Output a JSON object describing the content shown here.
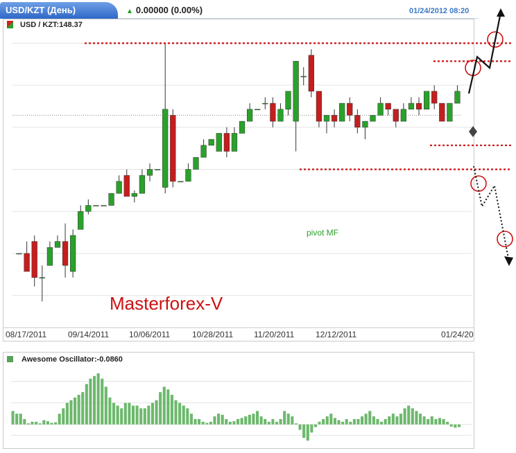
{
  "header": {
    "tab_title": "USD/KZT (День)",
    "change_text": "0.00000 (0.00%)",
    "datetime": "01/24/2012 08:20",
    "symbol_label": "USD / KZT:148.37"
  },
  "chart_data": [
    {
      "type": "candlestick",
      "title": "USD/KZT (День)",
      "x_tick_labels": [
        "08/17/2011",
        "09/14/2011",
        "10/06/2011",
        "10/28/2011",
        "11/20/2011",
        "12/12/2011",
        "01/24/20"
      ],
      "annotations": [
        "Masterforex-V",
        "pivot MF"
      ],
      "colors": {
        "up": "#2aa12a",
        "down": "#c41e1e",
        "levels": "#cc1111"
      },
      "grid": true,
      "candles": [
        {
          "o": 0.86,
          "c": 0.86,
          "h": 0.86,
          "l": 0.86
        },
        {
          "o": 0.86,
          "c": 0.8,
          "h": 0.9,
          "l": 0.8
        },
        {
          "o": 0.9,
          "c": 0.78,
          "h": 0.92,
          "l": 0.75
        },
        {
          "o": 0.78,
          "c": 0.78,
          "h": 0.82,
          "l": 0.7
        },
        {
          "o": 0.82,
          "c": 0.88,
          "h": 0.9,
          "l": 0.82
        },
        {
          "o": 0.88,
          "c": 0.9,
          "h": 0.92,
          "l": 0.88
        },
        {
          "o": 0.9,
          "c": 0.82,
          "h": 0.96,
          "l": 0.78
        },
        {
          "o": 0.8,
          "c": 0.92,
          "h": 0.94,
          "l": 0.78
        },
        {
          "o": 0.94,
          "c": 1.0,
          "h": 1.02,
          "l": 0.94
        },
        {
          "o": 1.0,
          "c": 1.02,
          "h": 1.04,
          "l": 0.99
        },
        {
          "o": 1.02,
          "c": 1.02,
          "h": 1.02,
          "l": 1.02
        },
        {
          "o": 1.02,
          "c": 1.02,
          "h": 1.02,
          "l": 1.02
        },
        {
          "o": 1.02,
          "c": 1.06,
          "h": 1.06,
          "l": 1.02
        },
        {
          "o": 1.06,
          "c": 1.1,
          "h": 1.12,
          "l": 1.06
        },
        {
          "o": 1.12,
          "c": 1.05,
          "h": 1.14,
          "l": 1.05
        },
        {
          "o": 1.05,
          "c": 1.06,
          "h": 1.07,
          "l": 1.03
        },
        {
          "o": 1.06,
          "c": 1.12,
          "h": 1.14,
          "l": 1.06
        },
        {
          "o": 1.12,
          "c": 1.14,
          "h": 1.16,
          "l": 1.1
        },
        {
          "o": 1.14,
          "c": 1.14,
          "h": 1.14,
          "l": 1.14
        },
        {
          "o": 1.08,
          "c": 1.34,
          "h": 1.56,
          "l": 1.06
        },
        {
          "o": 1.32,
          "c": 1.1,
          "h": 1.34,
          "l": 1.08
        },
        {
          "o": 1.1,
          "c": 1.1,
          "h": 1.1,
          "l": 1.1
        },
        {
          "o": 1.1,
          "c": 1.14,
          "h": 1.16,
          "l": 1.1
        },
        {
          "o": 1.14,
          "c": 1.18,
          "h": 1.18,
          "l": 1.14
        },
        {
          "o": 1.18,
          "c": 1.22,
          "h": 1.24,
          "l": 1.18
        },
        {
          "o": 1.22,
          "c": 1.24,
          "h": 1.24,
          "l": 1.22
        },
        {
          "o": 1.2,
          "c": 1.26,
          "h": 1.26,
          "l": 1.2
        },
        {
          "o": 1.26,
          "c": 1.2,
          "h": 1.28,
          "l": 1.18
        },
        {
          "o": 1.2,
          "c": 1.26,
          "h": 1.28,
          "l": 1.2
        },
        {
          "o": 1.26,
          "c": 1.3,
          "h": 1.3,
          "l": 1.26
        },
        {
          "o": 1.3,
          "c": 1.34,
          "h": 1.36,
          "l": 1.3
        },
        {
          "o": 1.34,
          "c": 1.34,
          "h": 1.34,
          "l": 1.34
        },
        {
          "o": 1.36,
          "c": 1.36,
          "h": 1.38,
          "l": 1.34
        },
        {
          "o": 1.36,
          "c": 1.3,
          "h": 1.38,
          "l": 1.28
        },
        {
          "o": 1.3,
          "c": 1.34,
          "h": 1.36,
          "l": 1.3
        },
        {
          "o": 1.34,
          "c": 1.4,
          "h": 1.4,
          "l": 1.32
        },
        {
          "o": 1.3,
          "c": 1.5,
          "h": 1.5,
          "l": 1.2
        },
        {
          "o": 1.45,
          "c": 1.45,
          "h": 1.48,
          "l": 1.42
        },
        {
          "o": 1.52,
          "c": 1.4,
          "h": 1.54,
          "l": 1.38
        },
        {
          "o": 1.4,
          "c": 1.3,
          "h": 1.4,
          "l": 1.28
        },
        {
          "o": 1.3,
          "c": 1.32,
          "h": 1.32,
          "l": 1.26
        },
        {
          "o": 1.32,
          "c": 1.3,
          "h": 1.34,
          "l": 1.28
        },
        {
          "o": 1.3,
          "c": 1.36,
          "h": 1.36,
          "l": 1.3
        },
        {
          "o": 1.36,
          "c": 1.32,
          "h": 1.38,
          "l": 1.3
        },
        {
          "o": 1.32,
          "c": 1.28,
          "h": 1.34,
          "l": 1.26
        },
        {
          "o": 1.28,
          "c": 1.3,
          "h": 1.3,
          "l": 1.24
        },
        {
          "o": 1.3,
          "c": 1.32,
          "h": 1.32,
          "l": 1.3
        },
        {
          "o": 1.32,
          "c": 1.36,
          "h": 1.38,
          "l": 1.32
        },
        {
          "o": 1.36,
          "c": 1.34,
          "h": 1.36,
          "l": 1.32
        },
        {
          "o": 1.34,
          "c": 1.3,
          "h": 1.34,
          "l": 1.28
        },
        {
          "o": 1.3,
          "c": 1.34,
          "h": 1.36,
          "l": 1.3
        },
        {
          "o": 1.34,
          "c": 1.36,
          "h": 1.38,
          "l": 1.34
        },
        {
          "o": 1.36,
          "c": 1.34,
          "h": 1.38,
          "l": 1.32
        },
        {
          "o": 1.34,
          "c": 1.4,
          "h": 1.4,
          "l": 1.34
        },
        {
          "o": 1.4,
          "c": 1.36,
          "h": 1.42,
          "l": 1.34
        },
        {
          "o": 1.36,
          "c": 1.3,
          "h": 1.36,
          "l": 1.3
        },
        {
          "o": 1.3,
          "c": 1.36,
          "h": 1.36,
          "l": 1.3
        },
        {
          "o": 1.36,
          "c": 1.4,
          "h": 1.42,
          "l": 1.36
        }
      ],
      "levels": [
        "1.56",
        "1.50",
        "1.22",
        "1.14"
      ]
    },
    {
      "type": "bar",
      "title": "Awesome Oscillator:-0.0860",
      "colors": {
        "bars": "#6db86d"
      },
      "values": [
        0.25,
        0.2,
        0.2,
        0.1,
        0.02,
        0.05,
        0.05,
        0.02,
        0.08,
        0.06,
        0.03,
        0.04,
        0.2,
        0.3,
        0.4,
        0.45,
        0.5,
        0.55,
        0.6,
        0.75,
        0.85,
        0.9,
        0.95,
        0.85,
        0.7,
        0.5,
        0.4,
        0.35,
        0.3,
        0.4,
        0.4,
        0.35,
        0.35,
        0.3,
        0.3,
        0.35,
        0.4,
        0.45,
        0.6,
        0.7,
        0.65,
        0.55,
        0.45,
        0.4,
        0.35,
        0.3,
        0.2,
        0.1,
        0.1,
        0.05,
        0.03,
        0.05,
        0.15,
        0.2,
        0.18,
        0.1,
        0.05,
        0.06,
        0.1,
        0.12,
        0.15,
        0.18,
        0.2,
        0.25,
        0.15,
        0.1,
        0.05,
        0.1,
        0.05,
        0.1,
        0.25,
        0.2,
        0.15,
        0.02,
        -0.1,
        -0.25,
        -0.3,
        -0.15,
        -0.05,
        0.05,
        0.1,
        0.15,
        0.2,
        0.12,
        0.08,
        0.05,
        0.1,
        0.05,
        0.1,
        0.1,
        0.15,
        0.2,
        0.25,
        0.15,
        0.1,
        0.05,
        0.1,
        0.15,
        0.2,
        0.15,
        0.2,
        0.3,
        0.35,
        0.3,
        0.25,
        0.2,
        0.15,
        0.1,
        0.15,
        0.1,
        0.12,
        0.1,
        0.05,
        -0.04,
        -0.06,
        -0.05
      ],
      "ylim": [
        -0.35,
        1.0
      ]
    }
  ]
}
